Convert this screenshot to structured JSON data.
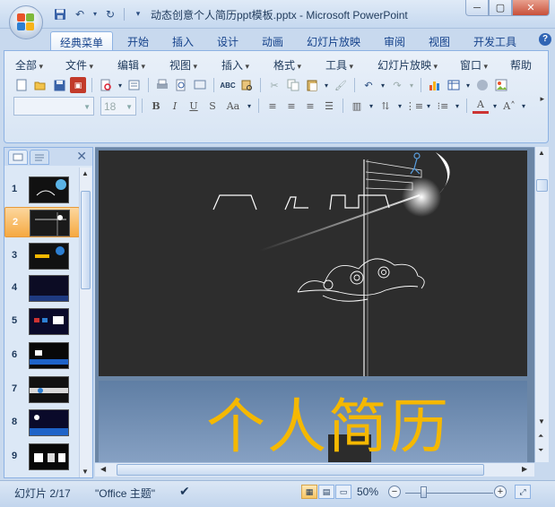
{
  "window": {
    "title": "动态创意个人简历ppt模板.pptx - Microsoft PowerPoint"
  },
  "ribbon_tabs": [
    {
      "label": "经典菜单",
      "active": true
    },
    {
      "label": "开始",
      "active": false
    },
    {
      "label": "插入",
      "active": false
    },
    {
      "label": "设计",
      "active": false
    },
    {
      "label": "动画",
      "active": false
    },
    {
      "label": "幻灯片放映",
      "active": false
    },
    {
      "label": "审阅",
      "active": false
    },
    {
      "label": "视图",
      "active": false
    },
    {
      "label": "开发工具",
      "active": false
    }
  ],
  "classic_menu": [
    "全部",
    "文件",
    "编辑",
    "视图",
    "插入",
    "格式",
    "工具",
    "幻灯片放映",
    "窗口",
    "帮助"
  ],
  "font_size": "18",
  "thumbnails": [
    {
      "num": "1",
      "selected": false
    },
    {
      "num": "2",
      "selected": true
    },
    {
      "num": "3",
      "selected": false
    },
    {
      "num": "4",
      "selected": false
    },
    {
      "num": "5",
      "selected": false
    },
    {
      "num": "6",
      "selected": false
    },
    {
      "num": "7",
      "selected": false
    },
    {
      "num": "8",
      "selected": false
    },
    {
      "num": "9",
      "selected": false
    }
  ],
  "slide": {
    "title": "个人简历",
    "bg_color": "#2d2d2d",
    "title_color": "#f5b800"
  },
  "status": {
    "slide_info": "幻灯片 2/17",
    "theme": "\"Office 主题\"",
    "zoom": "50%"
  }
}
